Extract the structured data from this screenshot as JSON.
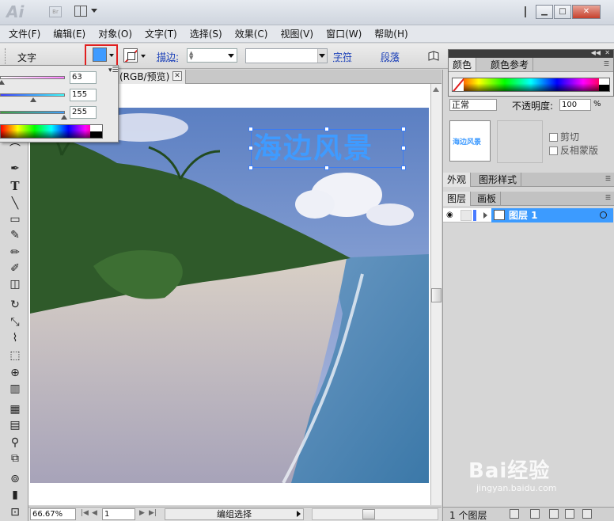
{
  "window": {
    "app_logo": "Ai",
    "bridge_logo": "Br",
    "minimize": "▁",
    "maximize": "□",
    "close": "✕"
  },
  "menu": [
    "文件(F)",
    "编辑(E)",
    "对象(O)",
    "文字(T)",
    "选择(S)",
    "效果(C)",
    "视图(V)",
    "窗口(W)",
    "帮助(H)"
  ],
  "control_bar": {
    "tool_label": "文字",
    "fill_color": "#3f9bff",
    "stroke_label": "描边:",
    "character_link": "字符",
    "paragraph_link": "段落"
  },
  "color_popup": {
    "values": [
      "63",
      "155",
      "255"
    ]
  },
  "document": {
    "tab_title": "(RGB/预览)",
    "close_glyph": "✕",
    "text_object": "海边风景"
  },
  "status_bar": {
    "zoom": "66.67%",
    "page": "1",
    "status": "编组选择"
  },
  "panels": {
    "color_tabs": [
      "颜色",
      "颜色参考"
    ],
    "transparency": {
      "blend_mode": "正常",
      "opacity_label": "不透明度:",
      "opacity_value": "100",
      "opacity_unit": "%",
      "thumb_text": "海边风景",
      "clip_label": "剪切",
      "invert_label": "反相蒙版"
    },
    "appearance_tabs": [
      "外观",
      "图形样式"
    ],
    "layer_tabs": [
      "图层",
      "画板"
    ],
    "layers": [
      {
        "name": "图层 1",
        "color": "#4a7cff",
        "selected": true
      }
    ],
    "layers_count": "1 个图层"
  },
  "watermark": {
    "logo": "Bai经验",
    "url": "jingyan.baidu.com"
  }
}
